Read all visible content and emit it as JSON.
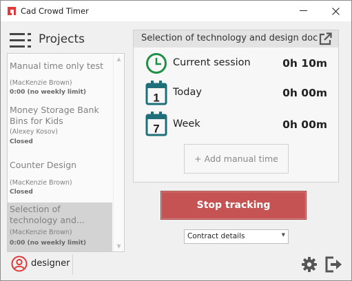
{
  "window": {
    "title": "Cad Crowd Timer",
    "minimize_glyph": "—",
    "close_glyph": "✕"
  },
  "sidebar": {
    "title": "Projects",
    "projects": [
      {
        "name": "Manual time only test",
        "client": "(MacKenzie Brown)",
        "status": "0:00 (no weekly limit)"
      },
      {
        "name": "Money Storage Bank Bins for Kids",
        "client": "(Alexey Kosov)",
        "status": "Closed"
      },
      {
        "name": "Counter Design",
        "client": "(MacKenzie Brown)",
        "status": "Closed"
      },
      {
        "name": "Selection of technology and...",
        "client": "(MacKenzie Brown)",
        "status": "0:00 (no weekly limit)"
      }
    ]
  },
  "footer": {
    "username": "designer"
  },
  "main": {
    "project_title": "Selection of technology and design doc",
    "stats": [
      {
        "label": "Current session",
        "value": "0h 10m",
        "icon": "clock-icon"
      },
      {
        "label": "Today",
        "value": "0h 00m",
        "icon": "calendar-day-icon",
        "day": "1"
      },
      {
        "label": "Week",
        "value": "0h 00m",
        "icon": "calendar-week-icon",
        "day": "7"
      }
    ],
    "add_manual_time": "+ Add manual time",
    "stop_button": "Stop tracking",
    "contract_select": "Contract details"
  },
  "colors": {
    "accent_green": "#1f8f45",
    "accent_teal": "#1f6f7a",
    "stop_red": "#c65353",
    "logo_red": "#e03a3a"
  }
}
